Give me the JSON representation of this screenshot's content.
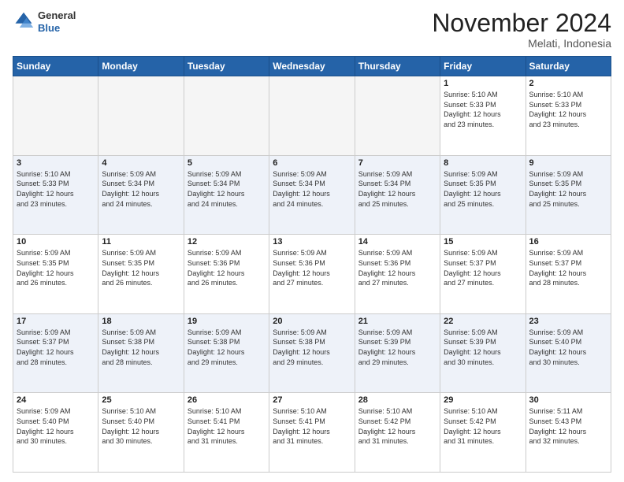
{
  "header": {
    "logo_line1": "General",
    "logo_line2": "Blue",
    "month_title": "November 2024",
    "location": "Melati, Indonesia"
  },
  "weekdays": [
    "Sunday",
    "Monday",
    "Tuesday",
    "Wednesday",
    "Thursday",
    "Friday",
    "Saturday"
  ],
  "weeks": [
    [
      {
        "day": "",
        "info": ""
      },
      {
        "day": "",
        "info": ""
      },
      {
        "day": "",
        "info": ""
      },
      {
        "day": "",
        "info": ""
      },
      {
        "day": "",
        "info": ""
      },
      {
        "day": "1",
        "info": "Sunrise: 5:10 AM\nSunset: 5:33 PM\nDaylight: 12 hours\nand 23 minutes."
      },
      {
        "day": "2",
        "info": "Sunrise: 5:10 AM\nSunset: 5:33 PM\nDaylight: 12 hours\nand 23 minutes."
      }
    ],
    [
      {
        "day": "3",
        "info": "Sunrise: 5:10 AM\nSunset: 5:33 PM\nDaylight: 12 hours\nand 23 minutes."
      },
      {
        "day": "4",
        "info": "Sunrise: 5:09 AM\nSunset: 5:34 PM\nDaylight: 12 hours\nand 24 minutes."
      },
      {
        "day": "5",
        "info": "Sunrise: 5:09 AM\nSunset: 5:34 PM\nDaylight: 12 hours\nand 24 minutes."
      },
      {
        "day": "6",
        "info": "Sunrise: 5:09 AM\nSunset: 5:34 PM\nDaylight: 12 hours\nand 24 minutes."
      },
      {
        "day": "7",
        "info": "Sunrise: 5:09 AM\nSunset: 5:34 PM\nDaylight: 12 hours\nand 25 minutes."
      },
      {
        "day": "8",
        "info": "Sunrise: 5:09 AM\nSunset: 5:35 PM\nDaylight: 12 hours\nand 25 minutes."
      },
      {
        "day": "9",
        "info": "Sunrise: 5:09 AM\nSunset: 5:35 PM\nDaylight: 12 hours\nand 25 minutes."
      }
    ],
    [
      {
        "day": "10",
        "info": "Sunrise: 5:09 AM\nSunset: 5:35 PM\nDaylight: 12 hours\nand 26 minutes."
      },
      {
        "day": "11",
        "info": "Sunrise: 5:09 AM\nSunset: 5:35 PM\nDaylight: 12 hours\nand 26 minutes."
      },
      {
        "day": "12",
        "info": "Sunrise: 5:09 AM\nSunset: 5:36 PM\nDaylight: 12 hours\nand 26 minutes."
      },
      {
        "day": "13",
        "info": "Sunrise: 5:09 AM\nSunset: 5:36 PM\nDaylight: 12 hours\nand 27 minutes."
      },
      {
        "day": "14",
        "info": "Sunrise: 5:09 AM\nSunset: 5:36 PM\nDaylight: 12 hours\nand 27 minutes."
      },
      {
        "day": "15",
        "info": "Sunrise: 5:09 AM\nSunset: 5:37 PM\nDaylight: 12 hours\nand 27 minutes."
      },
      {
        "day": "16",
        "info": "Sunrise: 5:09 AM\nSunset: 5:37 PM\nDaylight: 12 hours\nand 28 minutes."
      }
    ],
    [
      {
        "day": "17",
        "info": "Sunrise: 5:09 AM\nSunset: 5:37 PM\nDaylight: 12 hours\nand 28 minutes."
      },
      {
        "day": "18",
        "info": "Sunrise: 5:09 AM\nSunset: 5:38 PM\nDaylight: 12 hours\nand 28 minutes."
      },
      {
        "day": "19",
        "info": "Sunrise: 5:09 AM\nSunset: 5:38 PM\nDaylight: 12 hours\nand 29 minutes."
      },
      {
        "day": "20",
        "info": "Sunrise: 5:09 AM\nSunset: 5:38 PM\nDaylight: 12 hours\nand 29 minutes."
      },
      {
        "day": "21",
        "info": "Sunrise: 5:09 AM\nSunset: 5:39 PM\nDaylight: 12 hours\nand 29 minutes."
      },
      {
        "day": "22",
        "info": "Sunrise: 5:09 AM\nSunset: 5:39 PM\nDaylight: 12 hours\nand 30 minutes."
      },
      {
        "day": "23",
        "info": "Sunrise: 5:09 AM\nSunset: 5:40 PM\nDaylight: 12 hours\nand 30 minutes."
      }
    ],
    [
      {
        "day": "24",
        "info": "Sunrise: 5:09 AM\nSunset: 5:40 PM\nDaylight: 12 hours\nand 30 minutes."
      },
      {
        "day": "25",
        "info": "Sunrise: 5:10 AM\nSunset: 5:40 PM\nDaylight: 12 hours\nand 30 minutes."
      },
      {
        "day": "26",
        "info": "Sunrise: 5:10 AM\nSunset: 5:41 PM\nDaylight: 12 hours\nand 31 minutes."
      },
      {
        "day": "27",
        "info": "Sunrise: 5:10 AM\nSunset: 5:41 PM\nDaylight: 12 hours\nand 31 minutes."
      },
      {
        "day": "28",
        "info": "Sunrise: 5:10 AM\nSunset: 5:42 PM\nDaylight: 12 hours\nand 31 minutes."
      },
      {
        "day": "29",
        "info": "Sunrise: 5:10 AM\nSunset: 5:42 PM\nDaylight: 12 hours\nand 31 minutes."
      },
      {
        "day": "30",
        "info": "Sunrise: 5:11 AM\nSunset: 5:43 PM\nDaylight: 12 hours\nand 32 minutes."
      }
    ]
  ]
}
